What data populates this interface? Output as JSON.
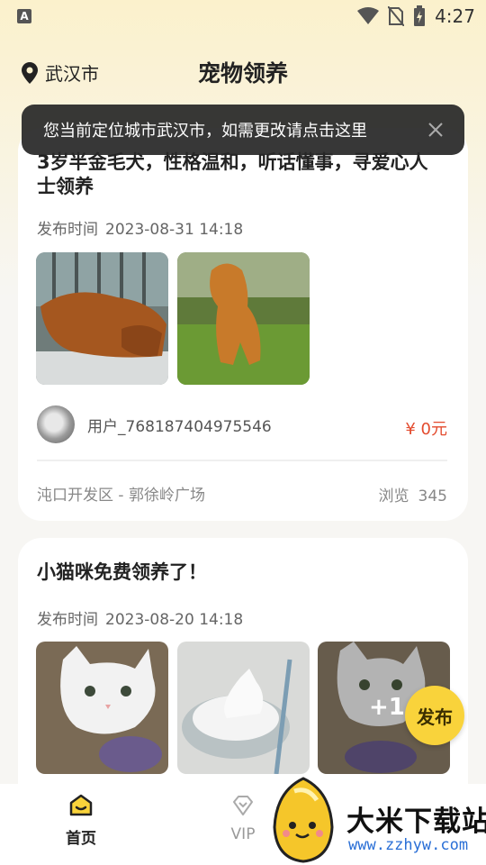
{
  "status_bar": {
    "time": "4:27",
    "app_icon_letter": "A"
  },
  "header": {
    "city": "武汉市",
    "title": "宠物领养"
  },
  "toast": {
    "message": "您当前定位城市武汉市，如需更改请点击这里"
  },
  "posts": [
    {
      "title": "3岁半金毛犬，性格温和，听话懂事，寻爱心人士领养",
      "time_label": "发布时间",
      "time": "2023-08-31 14:18",
      "photos": [
        "golden-retriever-lying",
        "golden-retriever-sitting"
      ],
      "user": "用户_768187404975546",
      "price": "¥ 0元",
      "address": "沌口开发区 - 郭徐岭广场",
      "views_label": "浏览",
      "views": "345"
    },
    {
      "title": "小猫咪免费领养了！",
      "time_label": "发布时间",
      "time": "2023-08-20 14:18",
      "photos": [
        "white-cat-closeup",
        "white-cat-in-basket",
        "white-cat-sitting"
      ],
      "more_photos": "+1"
    }
  ],
  "fab": {
    "label": "发布"
  },
  "nav": {
    "home": "首页",
    "vip": "VIP"
  },
  "watermark": {
    "title": "大米下载站",
    "url": "www.zzhyw.com"
  },
  "colors": {
    "accent": "#f9d33b",
    "price": "#e34b2e",
    "toast_bg": "#282828"
  }
}
